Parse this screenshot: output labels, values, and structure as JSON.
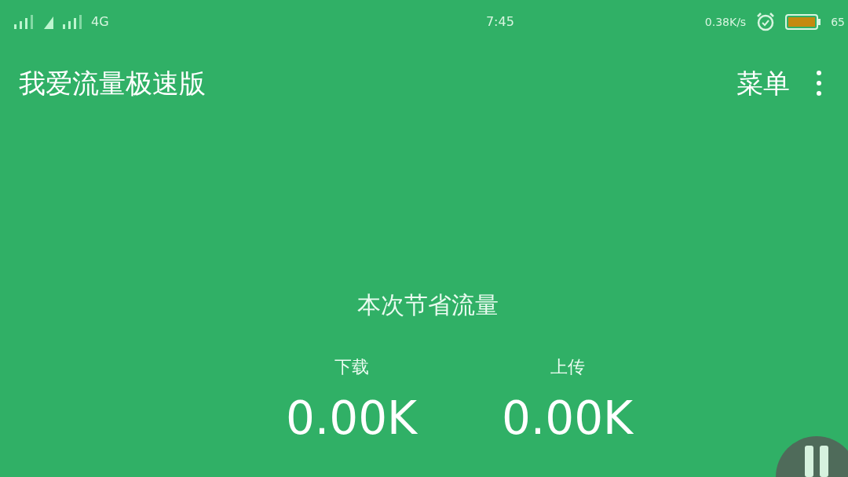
{
  "status_bar": {
    "network": "4G",
    "time": "7:45",
    "speed": "0.38K/s",
    "battery": "65"
  },
  "toolbar": {
    "title": "我爱流量极速版",
    "menu": "菜单"
  },
  "summary": {
    "heading": "本次节省流量",
    "stats": [
      {
        "label": "下载",
        "value": "0.00K"
      },
      {
        "label": "上传",
        "value": "0.00K"
      }
    ]
  }
}
